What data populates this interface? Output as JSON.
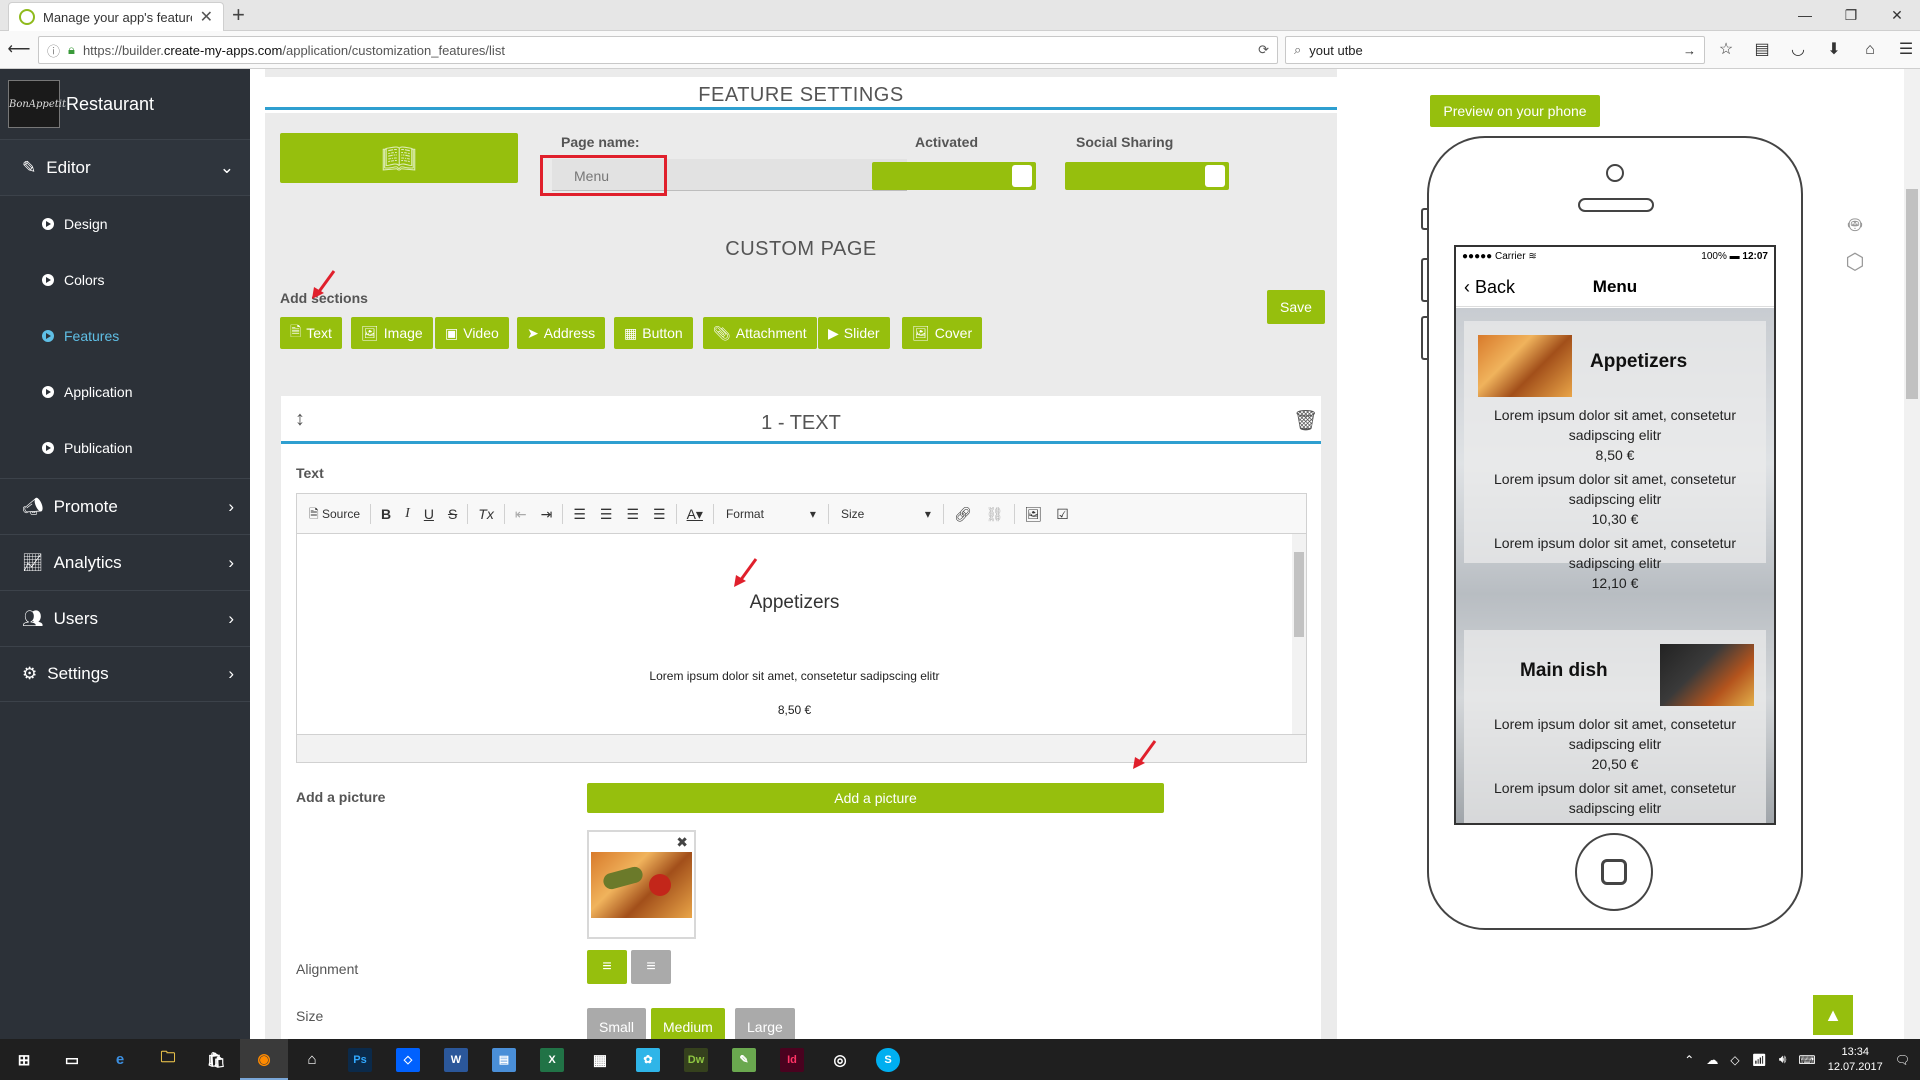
{
  "browser": {
    "tab_title": "Manage your app's features",
    "url_prefix": "https://builder.",
    "url_host": "create-my-apps.com",
    "url_path": "/application/customization_features/list",
    "search_text": "yout utbe"
  },
  "sidebar": {
    "brand_logo_text": "BonAppetit",
    "brand_name": "Restaurant",
    "editor_label": "Editor",
    "sub_items": [
      {
        "label": "Design"
      },
      {
        "label": "Colors"
      },
      {
        "label": "Features"
      },
      {
        "label": "Application"
      },
      {
        "label": "Publication"
      }
    ],
    "sections": [
      {
        "label": "Promote"
      },
      {
        "label": "Analytics"
      },
      {
        "label": "Users"
      },
      {
        "label": "Settings"
      }
    ]
  },
  "feature_settings": {
    "title": "FEATURE SETTINGS",
    "page_name_label": "Page name:",
    "page_name_value": "Menu",
    "activated_label": "Activated",
    "social_label": "Social Sharing",
    "activated_on": true,
    "social_on": true
  },
  "custom_page": {
    "title": "CUSTOM PAGE",
    "add_sections_label": "Add sections",
    "save_label": "Save",
    "section_buttons": [
      {
        "label": "Text",
        "icon": "file-text-icon"
      },
      {
        "label": "Image",
        "icon": "image-icon"
      },
      {
        "label": "Video",
        "icon": "video-icon"
      },
      {
        "label": "Address",
        "icon": "location-arrow-icon"
      },
      {
        "label": "Button",
        "icon": "button-icon"
      },
      {
        "label": "Attachment",
        "icon": "paperclip-icon"
      },
      {
        "label": "Slider",
        "icon": "play-circle-icon"
      },
      {
        "label": "Cover",
        "icon": "picture-icon"
      }
    ]
  },
  "text_section": {
    "title": "1 - TEXT",
    "text_label": "Text",
    "toolbar": {
      "source_label": "Source",
      "format_label": "Format",
      "size_label": "Size"
    },
    "content_heading": "Appetizers",
    "content_line": "Lorem ipsum dolor sit amet, consetetur sadipscing elitr",
    "content_price": "8,50 €",
    "add_picture_label": "Add a picture",
    "add_picture_button": "Add a picture",
    "alignment_label": "Alignment",
    "size_label": "Size",
    "size_options": [
      "Small",
      "Medium",
      "Large"
    ],
    "size_selected": "Medium"
  },
  "preview": {
    "button_label": "Preview on your phone",
    "carrier": "Carrier",
    "time": "12:07",
    "battery": "100%",
    "back_label": "Back",
    "screen_title": "Menu",
    "cards": [
      {
        "title": "Appetizers",
        "lines": [
          "Lorem ipsum dolor sit amet, consetetur",
          "sadipscing elitr",
          "8,50 €",
          "Lorem ipsum dolor sit amet, consetetur",
          "sadipscing elitr",
          "10,30 €",
          "Lorem ipsum dolor sit amet, consetetur",
          "sadipscing elitr",
          "12,10 €"
        ]
      },
      {
        "title": "Main dish",
        "lines": [
          "Lorem ipsum dolor sit amet, consetetur",
          "sadipscing elitr",
          "20,50 €",
          "Lorem ipsum dolor sit amet, consetetur",
          "sadipscing elitr"
        ]
      }
    ]
  },
  "taskbar": {
    "apps": [
      "Ps",
      "W",
      "X",
      "Dw",
      "Id",
      "S"
    ],
    "time": "13:34",
    "date": "12.07.2017"
  },
  "colors": {
    "accent_green": "#96bf0d",
    "accent_blue": "#2e9fd0",
    "sidebar_bg": "#2c3138",
    "highlight_red": "#e0202c"
  }
}
